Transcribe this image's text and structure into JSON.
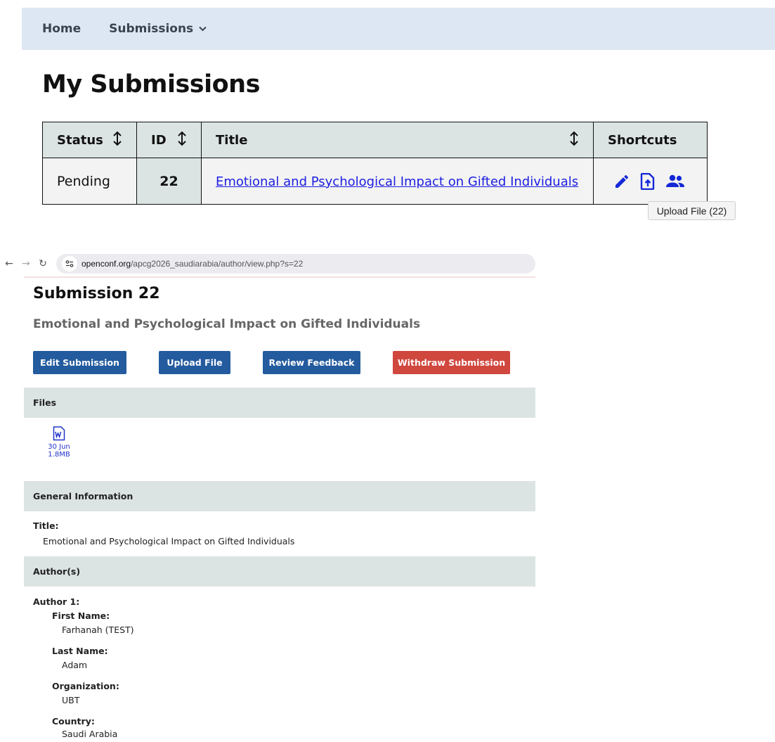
{
  "nav": {
    "home": "Home",
    "submissions": "Submissions",
    "chevron": "chevron-down-icon"
  },
  "page_title": "My Submissions",
  "table": {
    "headers": {
      "status": "Status",
      "id": "ID",
      "title": "Title",
      "shortcuts": "Shortcuts"
    },
    "rows": [
      {
        "status": "Pending",
        "id": "22",
        "title": "Emotional and Psychological Impact on Gifted Individuals",
        "shortcut_icons": [
          "edit-icon",
          "upload-file-icon",
          "authors-icon"
        ]
      }
    ]
  },
  "tooltip": "Upload File (22)",
  "browser": {
    "url_host": "openconf.org",
    "url_path": "/apcg2026_saudiarabia/author/view.php?s=22"
  },
  "submission": {
    "heading": "Submission 22",
    "subtitle": "Emotional and Psychological Impact on Gifted Individuals",
    "buttons": {
      "edit": "Edit Submission",
      "upload": "Upload File",
      "review": "Review Feedback",
      "withdraw": "Withdraw Submission"
    },
    "sections": {
      "files": "Files",
      "general": "General Information",
      "authors": "Author(s)"
    },
    "file": {
      "date": "30 Jun",
      "size": "1.8MB"
    },
    "general": {
      "title_label": "Title:",
      "title_value": "Emotional and Psychological Impact on Gifted Individuals"
    },
    "author1": {
      "label": "Author 1:",
      "first_name_label": "First Name:",
      "first_name": "Farhanah (TEST)",
      "last_name_label": "Last Name:",
      "last_name": "Adam",
      "org_label": "Organization:",
      "org": "UBT",
      "country_label": "Country:",
      "country": "Saudi Arabia"
    }
  },
  "colors": {
    "nav_bg": "#dde6f3",
    "header_bg": "#dce3e3",
    "link": "#1c1ee0",
    "btn_blue": "#235b9e",
    "btn_red": "#d0473e"
  }
}
